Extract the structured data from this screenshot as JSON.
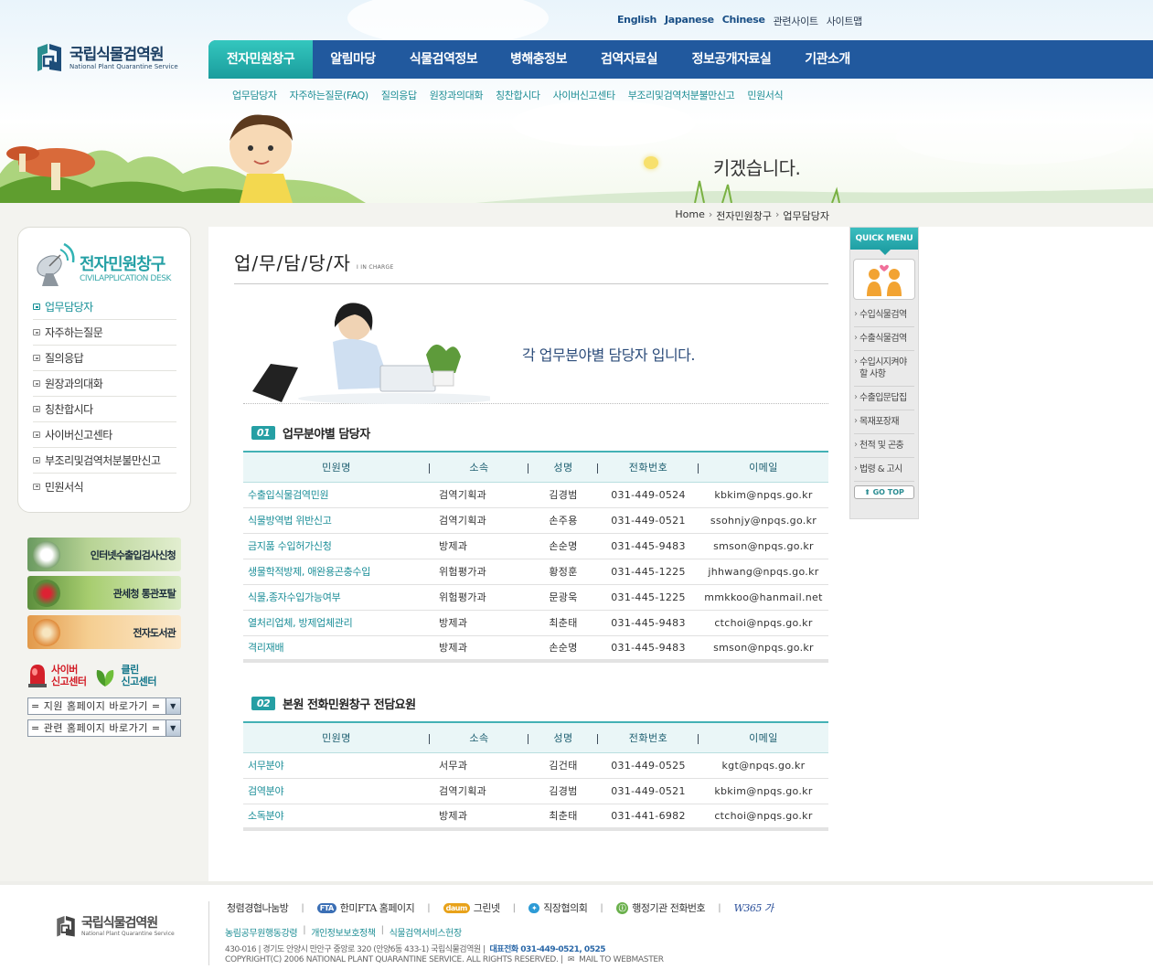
{
  "top_links": [
    "English",
    "Japanese",
    "Chinese",
    "관련사이트",
    "사이트맵"
  ],
  "logo": {
    "name": "국립식물검역원",
    "name_en": "National Plant Quarantine Service"
  },
  "gnb": [
    {
      "label": "전자민원창구",
      "active": true
    },
    {
      "label": "알림마당"
    },
    {
      "label": "식물검역정보"
    },
    {
      "label": "병해충정보"
    },
    {
      "label": "검역자료실"
    },
    {
      "label": "정보공개자료실"
    },
    {
      "label": "기관소개"
    }
  ],
  "lnb": [
    "업무담당자",
    "자주하는질문(FAQ)",
    "질의응답",
    "원장과의대화",
    "칭찬합시다",
    "사이버신고센타",
    "부조리및검역처분불만신고",
    "민원서식"
  ],
  "visual": {
    "slogan": "키겠습니다."
  },
  "breadcrumb": [
    "Home",
    "전자민원창구",
    "업무담당자"
  ],
  "side": {
    "title": "전자민원창구",
    "subtitle": "CIVILAPPLICATION DESK",
    "menu": [
      "업무담당자",
      "자주하는질문",
      "질의응답",
      "원장과의대화",
      "칭찬합시다",
      "사이버신고센타",
      "부조리및검역처분불만신고",
      "민원서식"
    ],
    "active_index": 0
  },
  "banners": [
    "인터넷수출입검사신청",
    "관세청 통관포탈",
    "전자도서관"
  ],
  "reports": {
    "cyber": [
      "사이버",
      "신고센터"
    ],
    "clean": [
      "클린",
      "신고센터"
    ]
  },
  "selects": [
    "= 지원 홈페이지 바로가기 =",
    "= 관련 홈페이지 바로가기 ="
  ],
  "page": {
    "title": "업/무/담/당/자",
    "title_en": "I IN CHARGE",
    "intro": "각 업무분야별 담당자 입니다."
  },
  "table_headers": [
    "민원명",
    "소속",
    "성명",
    "전화번호",
    "이메일"
  ],
  "section1": {
    "num": "01",
    "title": "업무분야별 담당자",
    "rows": [
      [
        "수출입식물검역민원",
        "검역기획과",
        "김경범",
        "031-449-0524",
        "kbkim@npqs.go.kr"
      ],
      [
        "식물방역법 위반신고",
        "검역기획과",
        "손주용",
        "031-449-0521",
        "ssohnjy@npqs.go.kr"
      ],
      [
        "금지품 수입허가신청",
        "방제과",
        "손순명",
        "031-445-9483",
        "smson@npqs.go.kr"
      ],
      [
        "생물학적방제, 애완용곤충수입",
        "위험평가과",
        "황정훈",
        "031-445-1225",
        "jhhwang@npqs.go.kr"
      ],
      [
        "식물,종자수입가능여부",
        "위험평가과",
        "문광욱",
        "031-445-1225",
        "mmkkoo@hanmail.net"
      ],
      [
        "열처리업체, 방제업체관리",
        "방제과",
        "최춘태",
        "031-445-9483",
        "ctchoi@npqs.go.kr"
      ],
      [
        "격리재배",
        "방제과",
        "손순명",
        "031-445-9483",
        "smson@npqs.go.kr"
      ]
    ]
  },
  "section2": {
    "num": "02",
    "title": "본원 전화민원창구 전담요원",
    "rows": [
      [
        "서무분야",
        "서무과",
        "김건태",
        "031-449-0525",
        "kgt@npqs.go.kr"
      ],
      [
        "검역분야",
        "검역기획과",
        "김경범",
        "031-449-0521",
        "kbkim@npqs.go.kr"
      ],
      [
        "소독분야",
        "방제과",
        "최춘태",
        "031-441-6982",
        "ctchoi@npqs.go.kr"
      ]
    ]
  },
  "quick": {
    "head": "QUICK MENU",
    "items": [
      "수입식물검역",
      "수출식물검역",
      "수입시지켜야 할 사항",
      "수출입문답집",
      "목재포장재",
      "천적 및 곤충",
      "법령 & 고시"
    ],
    "gotop": "GO TOP"
  },
  "footer": {
    "logo": "국립식물검역원",
    "logo_en": "National Plant Quarantine Service",
    "links": [
      "청렴경협나눔방",
      "한미FTA 홈페이지",
      "그린넷",
      "직장협의회",
      "행정기관 전화번호",
      "W365 가"
    ],
    "link_badges": [
      "",
      "FTA",
      "daum",
      "",
      "ⓘ",
      ""
    ],
    "policy": [
      "농림공무원행동강령",
      "개인정보보호정책",
      "식물검역서비스헌장"
    ],
    "address": "430-016 | 경기도 안양시 만안구 중앙로 320 (안양6동 433-1) 국립식물검역원 |",
    "tel": "대표전화 031-449-0521, 0525",
    "copyright": "COPYRIGHT(C) 2006 NATIONAL PLANT QUARANTINE SERVICE. ALL RIGHTS RESERVED. |",
    "mail": "MAIL TO WEBMASTER"
  },
  "colors": {
    "gnb": "#21599e",
    "accent": "#259fa4",
    "link": "#1b8e98"
  }
}
